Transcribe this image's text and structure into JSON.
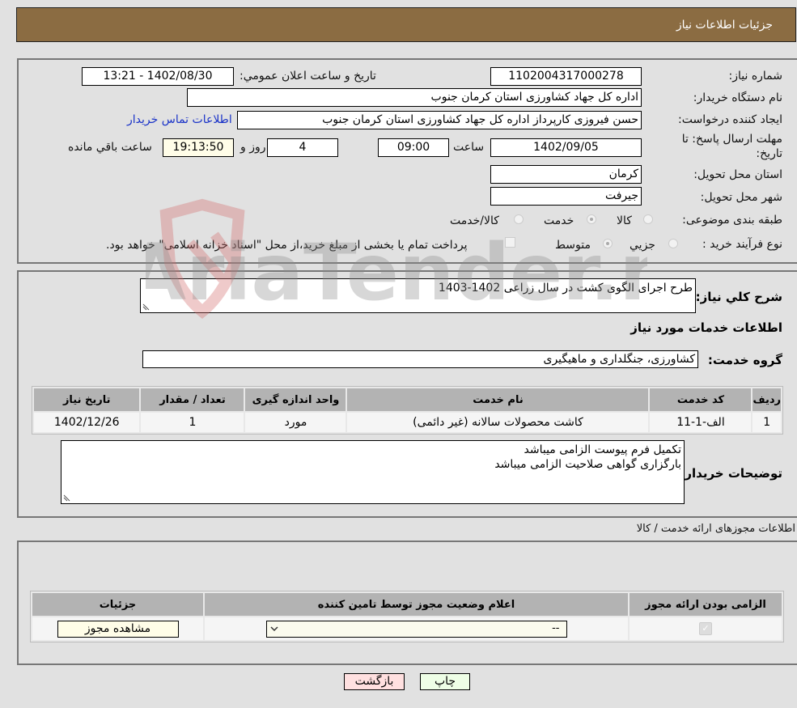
{
  "header": {
    "title": "جزئیات اطلاعات نیاز"
  },
  "form": {
    "need_number_label": "شماره نیاز:",
    "need_number": "1102004317000278",
    "announce_label": "تاریخ و ساعت اعلان عمومي:",
    "announce_value": "1402/08/30 - 13:21",
    "buyer_label": "نام دستگاه خریدار:",
    "buyer_value": "اداره کل جهاد کشاورزی استان کرمان   جنوب",
    "creator_label": "ایجاد کننده درخواست:",
    "creator_value": "حسن فیروزی کارپرداز اداره کل جهاد کشاورزی استان کرمان   جنوب",
    "contact_link": "اطلاعات تماس خریدار",
    "deadline_label_1": "مهلت ارسال پاسخ: تا",
    "deadline_label_2": "تاریخ:",
    "deadline_date": "1402/09/05",
    "hour_label": "ساعت",
    "deadline_time": "09:00",
    "days_value": "4",
    "days_label": "روز و",
    "remaining_value": "19:13:50",
    "remaining_label": "ساعت باقي مانده",
    "province_label": "استان محل تحویل:",
    "province_value": "کرمان",
    "city_label": "شهر محل تحویل:",
    "city_value": "جیرفت",
    "category_label": "طبقه بندی موضوعی:",
    "category_options": [
      {
        "label": "کالا",
        "checked": false
      },
      {
        "label": "خدمت",
        "checked": true
      },
      {
        "label": "کالا/خدمت",
        "checked": false
      }
    ],
    "process_label": "نوع فرآیند خرید :",
    "process_options": [
      {
        "label": "جزيي",
        "checked": false
      },
      {
        "label": "متوسط",
        "checked": true
      }
    ],
    "treasury_note": "پرداخت تمام یا بخشی از مبلغ خرید،از محل \"اسناد خزانه اسلامی\" خواهد بود."
  },
  "summary": {
    "description_label": "شرح کلي نیاز:",
    "description_value": "طرح اجرای الگوی کشت در سال زراعی 1402-1403",
    "services_title": "اطلاعات خدمات مورد نیاز",
    "service_group_label": "گروه خدمت:",
    "service_group_value": "کشاورزی، جنگلداری و ماهیگیری",
    "table": {
      "headers": [
        "ردیف",
        "کد خدمت",
        "نام خدمت",
        "واحد اندازه گیری",
        "تعداد / مقدار",
        "تاریخ نیاز"
      ],
      "rows": [
        [
          "1",
          "الف-1-11",
          "کاشت محصولات سالانه (غیر دائمی)",
          "مورد",
          "1",
          "1402/12/26"
        ]
      ]
    },
    "buyer_notes_label": "توضیحات خریدار:",
    "buyer_notes_line1": "تکمیل فرم پیوست الزامی میباشد",
    "buyer_notes_line2": "بارگزاری گواهی صلاحیت الزامی میباشد"
  },
  "permits": {
    "title": "اطلاعات مجوزهای ارائه خدمت / کالا",
    "headers": [
      "الزامی بودن ارائه مجوز",
      "اعلام وضعیت مجوز توسط تامین کننده",
      "جزئیات"
    ],
    "row": {
      "required": true,
      "status_selected": "--",
      "view_button": "مشاهده مجوز"
    }
  },
  "actions": {
    "print": "چاپ",
    "back": "بازگشت"
  },
  "watermark": "AriaTender.neT"
}
